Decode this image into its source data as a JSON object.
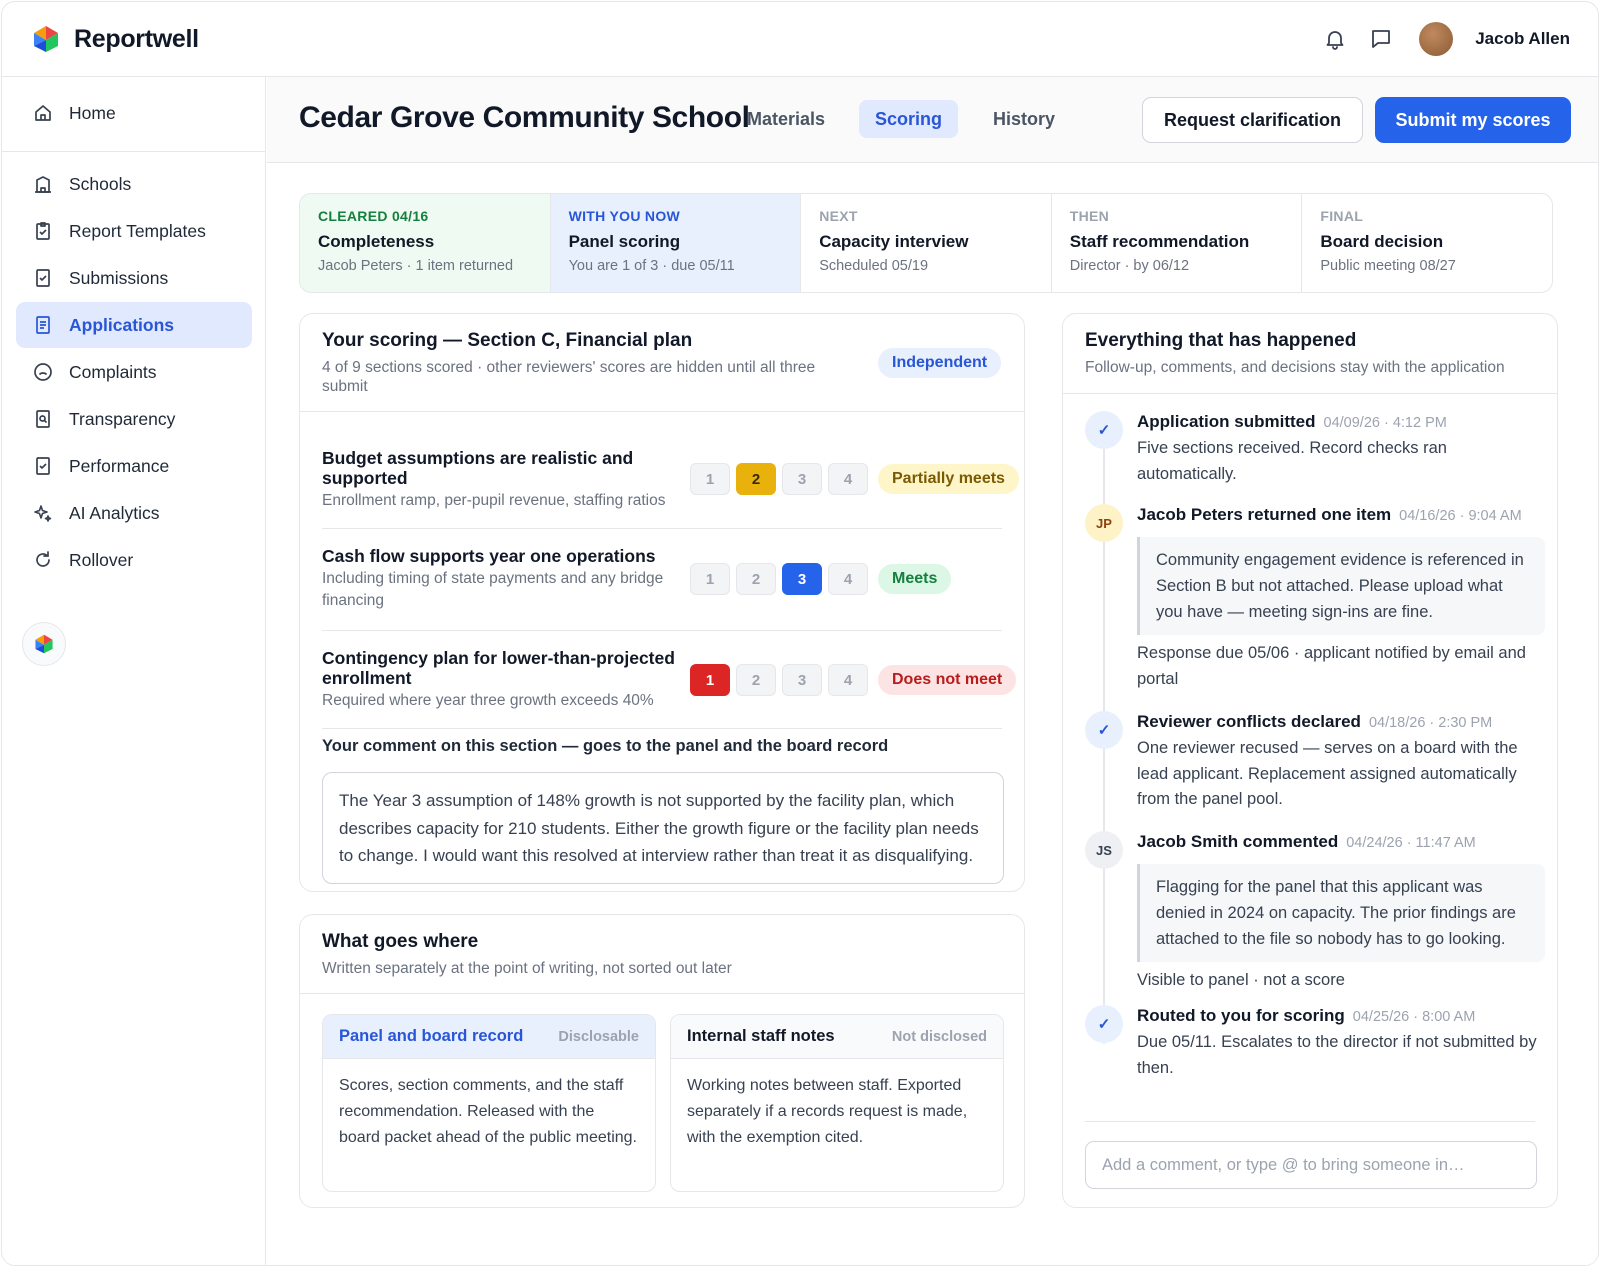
{
  "app": {
    "name": "Reportwell"
  },
  "user": {
    "name": "Jacob Allen"
  },
  "sidebar": {
    "items": [
      {
        "label": "Home",
        "icon": "home-icon"
      },
      {
        "label": "Schools",
        "icon": "school-icon"
      },
      {
        "label": "Report Templates",
        "icon": "clipboard-icon"
      },
      {
        "label": "Submissions",
        "icon": "check-document-icon"
      },
      {
        "label": "Applications",
        "icon": "document-icon",
        "active": true
      },
      {
        "label": "Complaints",
        "icon": "sad-face-icon"
      },
      {
        "label": "Transparency",
        "icon": "search-document-icon"
      },
      {
        "label": "Performance",
        "icon": "check-document-icon"
      },
      {
        "label": "AI Analytics",
        "icon": "sparkle-icon"
      },
      {
        "label": "Rollover",
        "icon": "refresh-icon"
      }
    ]
  },
  "header": {
    "title": "Cedar Grove Community School",
    "tabs": [
      {
        "label": "Materials"
      },
      {
        "label": "Scoring",
        "active": true
      },
      {
        "label": "History"
      }
    ],
    "request_label": "Request clarification",
    "submit_label": "Submit my scores"
  },
  "stages": [
    {
      "tag": "CLEARED 04/16",
      "title": "Completeness",
      "sub": "Jacob Peters · 1 item returned",
      "state": "done"
    },
    {
      "tag": "WITH YOU NOW",
      "title": "Panel scoring",
      "sub": "You are 1 of 3 · due 05/11",
      "state": "current"
    },
    {
      "tag": "NEXT",
      "title": "Capacity interview",
      "sub": "Scheduled 05/19",
      "state": "upcoming"
    },
    {
      "tag": "THEN",
      "title": "Staff recommendation",
      "sub": "Director · by 06/12",
      "state": "upcoming"
    },
    {
      "tag": "FINAL",
      "title": "Board decision",
      "sub": "Public meeting 08/27",
      "state": "upcoming"
    }
  ],
  "scoring": {
    "title": "Your scoring — Section C, Financial plan",
    "sub": "4 of 9 sections scored · other reviewers' scores are hidden until all three submit",
    "badge": "Independent",
    "scale": [
      "1",
      "2",
      "3",
      "4"
    ],
    "criteria": [
      {
        "title": "Budget assumptions are realistic and supported",
        "sub": "Enrollment ramp, per-pupil revenue, staffing ratios",
        "selected": 2,
        "rating": "Partially meets"
      },
      {
        "title": "Cash flow supports year one operations",
        "sub": "Including timing of state payments and any bridge financing",
        "selected": 3,
        "rating": "Meets"
      },
      {
        "title": "Contingency plan for lower-than-projected enrollment",
        "sub": "Required where year three growth exceeds 40%",
        "selected": 1,
        "rating": "Does not meet"
      }
    ],
    "comment_label": "Your comment on this section — goes to the panel and the board record",
    "comment_text": "The Year 3 assumption of 148% growth is not supported by the facility plan, which describes capacity for 210 students. Either the growth figure or the facility plan needs to change. I would want this resolved at interview rather than treat it as disqualifying."
  },
  "where": {
    "title": "What goes where",
    "sub": "Written separately at the point of writing, not sorted out later",
    "panel": {
      "title": "Panel and board record",
      "disclosure": "Disclosable",
      "body": "Scores, section comments, and the staff recommendation. Released with the board packet ahead of the public meeting."
    },
    "internal": {
      "title": "Internal staff notes",
      "disclosure": "Not disclosed",
      "body": "Working notes between staff. Exported separately if a records request is made, with the exemption cited."
    }
  },
  "history": {
    "title": "Everything that has happened",
    "sub": "Follow-up, comments, and decisions stay with the application",
    "events": [
      {
        "marker": "✓",
        "title": "Application submitted",
        "time": "04/09/26 · 4:12 PM",
        "text": "Five sections received. Record checks ran automatically."
      },
      {
        "marker": "JP",
        "title": "Jacob Peters returned one item",
        "time": "04/16/26 · 9:04 AM",
        "quote": "Community engagement evidence is referenced in Section B but not attached. Please upload what you have — meeting sign-ins are fine.",
        "text": "Response due 05/06 · applicant notified by email and portal"
      },
      {
        "marker": "✓",
        "title": "Reviewer conflicts declared",
        "time": "04/18/26 · 2:30 PM",
        "text": "One reviewer recused — serves on a board with the lead applicant. Replacement assigned automatically from the panel pool."
      },
      {
        "marker": "JS",
        "title": "Jacob Smith commented",
        "time": "04/24/26 · 11:47 AM",
        "quote": "Flagging for the panel that this applicant was denied in 2024 on capacity. The prior findings are attached to the file so nobody has to go looking.",
        "text": "Visible to panel · not a score"
      },
      {
        "marker": "✓",
        "title": "Routed to you for scoring",
        "time": "04/25/26 · 8:00 AM",
        "text": "Due 05/11. Escalates to the director if not submitted by then."
      }
    ],
    "input_placeholder": "Add a comment, or type @ to bring someone in…"
  },
  "colors": {
    "accent": "#2563eb",
    "done": "#15803d",
    "warn": "#e9b10b",
    "danger": "#dc2626"
  }
}
